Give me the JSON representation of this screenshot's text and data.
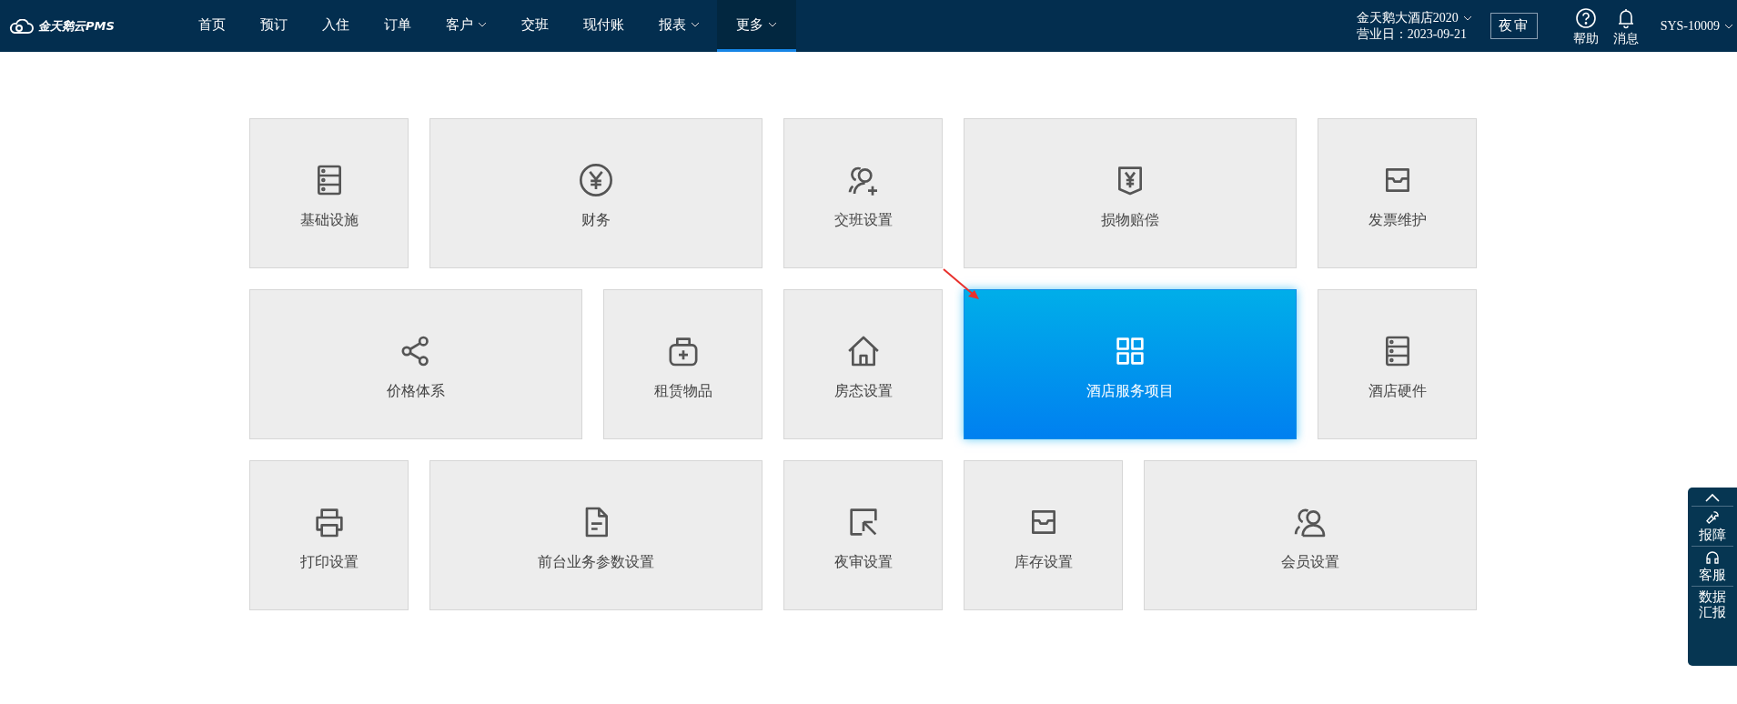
{
  "header": {
    "logo": "金天鹅云PMS",
    "nav": [
      {
        "label": "首页",
        "dropdown": false,
        "selected": false
      },
      {
        "label": "预订",
        "dropdown": false,
        "selected": false
      },
      {
        "label": "入住",
        "dropdown": false,
        "selected": false
      },
      {
        "label": "订单",
        "dropdown": false,
        "selected": false
      },
      {
        "label": "客户",
        "dropdown": true,
        "selected": false
      },
      {
        "label": "交班",
        "dropdown": false,
        "selected": false
      },
      {
        "label": "现付账",
        "dropdown": false,
        "selected": false
      },
      {
        "label": "报表",
        "dropdown": true,
        "selected": false
      },
      {
        "label": "更多",
        "dropdown": true,
        "selected": true
      }
    ],
    "hotel_name": "金天鹅大酒店2020",
    "business_day": "营业日：2023-09-21",
    "night_audit_button": "夜审",
    "help": "帮助",
    "messages": "消息",
    "user": "SYS-10009"
  },
  "tiles": [
    [
      {
        "label": "基础设施",
        "wide": false,
        "selected": false
      },
      {
        "label": "财务",
        "wide": true,
        "selected": false
      },
      {
        "label": "交班设置",
        "wide": false,
        "selected": false
      },
      {
        "label": "损物赔偿",
        "wide": true,
        "selected": false
      },
      {
        "label": "发票维护",
        "wide": false,
        "selected": false
      }
    ],
    [
      {
        "label": "价格体系",
        "wide": true,
        "selected": false
      },
      {
        "label": "租赁物品",
        "wide": false,
        "selected": false
      },
      {
        "label": "房态设置",
        "wide": false,
        "selected": false
      },
      {
        "label": "酒店服务项目",
        "wide": true,
        "selected": true
      },
      {
        "label": "酒店硬件",
        "wide": false,
        "selected": false
      }
    ],
    [
      {
        "label": "打印设置",
        "wide": false,
        "selected": false
      },
      {
        "label": "前台业务参数设置",
        "wide": true,
        "selected": false
      },
      {
        "label": "夜审设置",
        "wide": false,
        "selected": false
      },
      {
        "label": "库存设置",
        "wide": false,
        "selected": false
      },
      {
        "label": "会员设置",
        "wide": true,
        "selected": false
      }
    ]
  ],
  "side_panel": {
    "items": [
      "报障",
      "客服",
      "数据汇报"
    ]
  }
}
